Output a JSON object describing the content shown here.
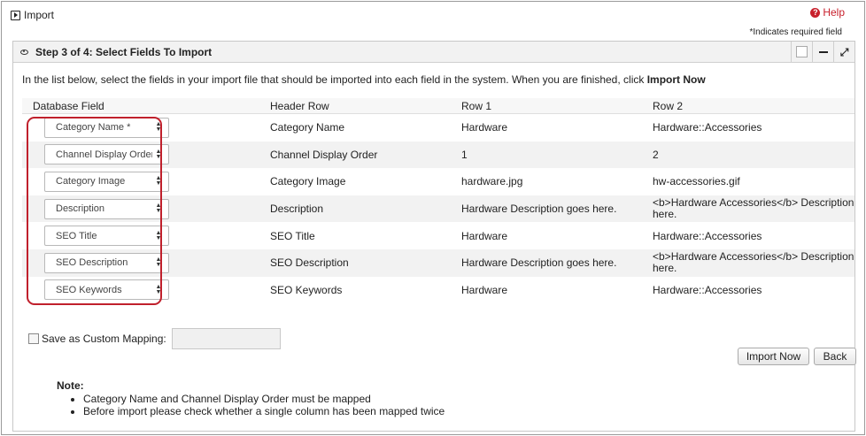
{
  "page": {
    "title": "Import",
    "help_label": "Help",
    "required_note": "*Indicates required field"
  },
  "panel": {
    "title": "Step 3 of 4: Select Fields To Import",
    "instructions_prefix": "In the list below, select the fields in your import file that should be imported into each field in the system. When you are finished, click ",
    "instructions_action": "Import Now"
  },
  "table": {
    "headers": [
      "Database Field",
      "Header Row",
      "Row 1",
      "Row 2"
    ],
    "rows": [
      {
        "field": "Category Name *",
        "header": "Category Name",
        "row1": "Hardware",
        "row2": "Hardware::Accessories"
      },
      {
        "field": "Channel Display Order",
        "header": "Channel Display Order",
        "row1": "1",
        "row2": "2"
      },
      {
        "field": "Category Image",
        "header": "Category Image",
        "row1": "hardware.jpg",
        "row2": "hw-accessories.gif"
      },
      {
        "field": "Description",
        "header": "Description",
        "row1": "Hardware Description goes here.",
        "row2": "<b>Hardware Accessories</b> Description goes here."
      },
      {
        "field": "SEO Title",
        "header": "SEO Title",
        "row1": "Hardware",
        "row2": "Hardware::Accessories"
      },
      {
        "field": "SEO Description",
        "header": "SEO Description",
        "row1": "Hardware Description goes here.",
        "row2": "<b>Hardware Accessories</b> Description goes here."
      },
      {
        "field": "SEO Keywords",
        "header": "SEO Keywords",
        "row1": "Hardware",
        "row2": "Hardware::Accessories"
      }
    ]
  },
  "save_mapping": {
    "label": "Save as Custom Mapping:",
    "value": ""
  },
  "buttons": {
    "import_now": "Import Now",
    "back": "Back"
  },
  "note": {
    "title": "Note:",
    "items": [
      "Category Name and Channel Display Order must be mapped",
      "Before import please check whether a single column has been mapped twice"
    ]
  },
  "colors": {
    "accent_red": "#c0202c",
    "header_bg": "#f2f2f2"
  }
}
